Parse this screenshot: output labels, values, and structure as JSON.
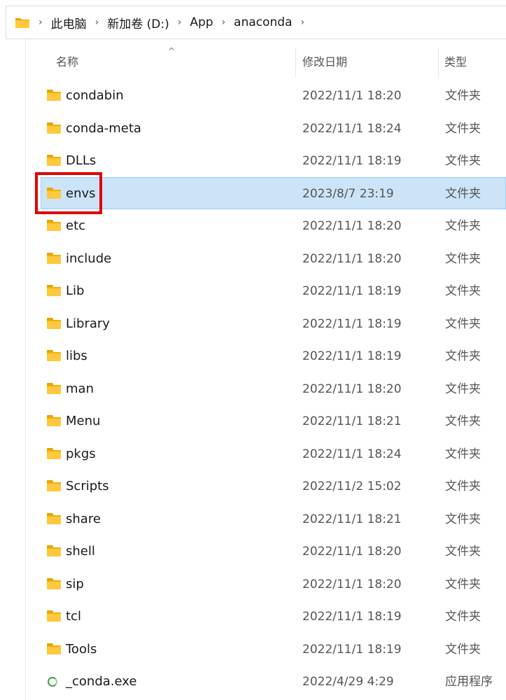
{
  "breadcrumb": {
    "items": [
      "此电脑",
      "新加卷 (D:)",
      "App",
      "anaconda"
    ]
  },
  "columns": {
    "name": "名称",
    "date": "修改日期",
    "type": "类型"
  },
  "files": [
    {
      "name": "condabin",
      "date": "2022/11/1 18:20",
      "type": "文件夹",
      "icon": "folder-icon"
    },
    {
      "name": "conda-meta",
      "date": "2022/11/1 18:24",
      "type": "文件夹",
      "icon": "folder-icon"
    },
    {
      "name": "DLLs",
      "date": "2022/11/1 18:19",
      "type": "文件夹",
      "icon": "folder-icon"
    },
    {
      "name": "envs",
      "date": "2023/8/7 23:19",
      "type": "文件夹",
      "icon": "folder-icon",
      "selected": true
    },
    {
      "name": "etc",
      "date": "2022/11/1 18:20",
      "type": "文件夹",
      "icon": "folder-icon"
    },
    {
      "name": "include",
      "date": "2022/11/1 18:20",
      "type": "文件夹",
      "icon": "folder-icon"
    },
    {
      "name": "Lib",
      "date": "2022/11/1 18:19",
      "type": "文件夹",
      "icon": "folder-icon"
    },
    {
      "name": "Library",
      "date": "2022/11/1 18:19",
      "type": "文件夹",
      "icon": "folder-icon"
    },
    {
      "name": "libs",
      "date": "2022/11/1 18:19",
      "type": "文件夹",
      "icon": "folder-icon"
    },
    {
      "name": "man",
      "date": "2022/11/1 18:20",
      "type": "文件夹",
      "icon": "folder-icon"
    },
    {
      "name": "Menu",
      "date": "2022/11/1 18:21",
      "type": "文件夹",
      "icon": "folder-icon"
    },
    {
      "name": "pkgs",
      "date": "2022/11/1 18:24",
      "type": "文件夹",
      "icon": "folder-icon"
    },
    {
      "name": "Scripts",
      "date": "2022/11/2 15:02",
      "type": "文件夹",
      "icon": "folder-icon"
    },
    {
      "name": "share",
      "date": "2022/11/1 18:21",
      "type": "文件夹",
      "icon": "folder-icon"
    },
    {
      "name": "shell",
      "date": "2022/11/1 18:20",
      "type": "文件夹",
      "icon": "folder-icon"
    },
    {
      "name": "sip",
      "date": "2022/11/1 18:20",
      "type": "文件夹",
      "icon": "folder-icon"
    },
    {
      "name": "tcl",
      "date": "2022/11/1 18:19",
      "type": "文件夹",
      "icon": "folder-icon"
    },
    {
      "name": "Tools",
      "date": "2022/11/1 18:19",
      "type": "文件夹",
      "icon": "folder-icon"
    },
    {
      "name": "_conda.exe",
      "date": "2022/4/29 4:29",
      "type": "应用程序",
      "icon": "conda-exe-icon"
    }
  ],
  "colors": {
    "selection_bg": "#cce4f7",
    "selection_border": "#99d1ff",
    "highlight": "#e00000",
    "folder": "#ffc83d"
  }
}
